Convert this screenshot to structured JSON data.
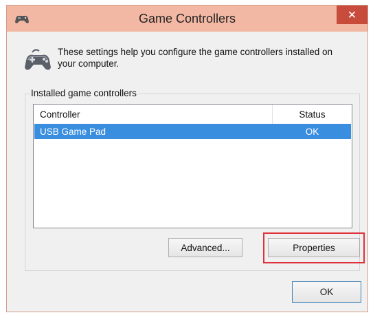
{
  "window": {
    "title": "Game Controllers",
    "close_label": "✕"
  },
  "intro": {
    "text_line1": "These settings help you configure the game controllers installed on",
    "text_line2": "your computer."
  },
  "group": {
    "legend": "Installed game controllers"
  },
  "list": {
    "columns": {
      "controller": "Controller",
      "status": "Status"
    },
    "rows": [
      {
        "controller": "USB Game Pad",
        "status": "OK",
        "selected": true
      }
    ]
  },
  "buttons": {
    "advanced": "Advanced...",
    "properties": "Properties",
    "ok": "OK"
  },
  "colors": {
    "titlebar": "#f2b8a3",
    "close": "#c74c3c",
    "selection": "#3a8ee0",
    "highlight": "#e0303a"
  },
  "icons": {
    "title": "gamepad-icon",
    "intro": "gamepad-icon"
  }
}
